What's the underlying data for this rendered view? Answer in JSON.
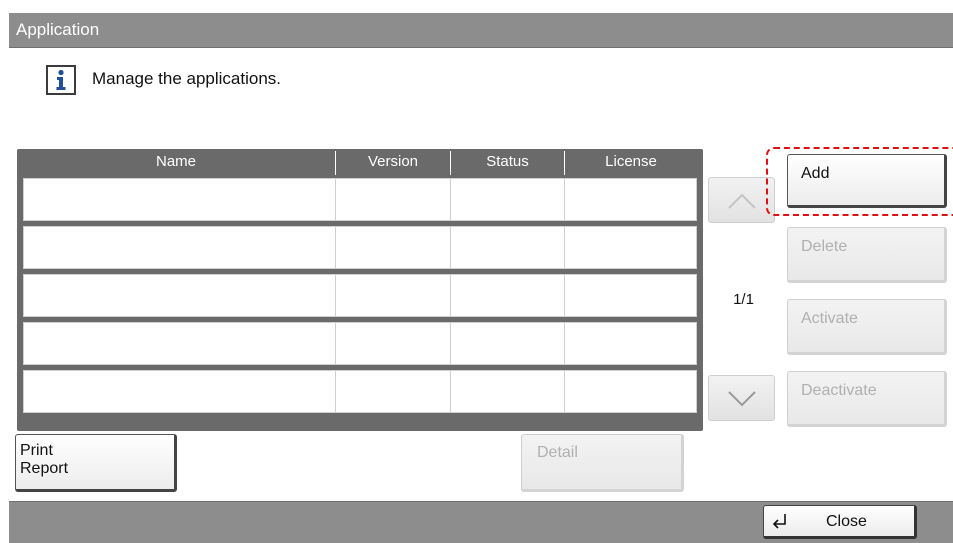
{
  "window": {
    "title": "Application"
  },
  "message": {
    "text": "Manage the applications.",
    "icon": "info-icon"
  },
  "table": {
    "columns": [
      "Name",
      "Version",
      "Status",
      "License"
    ],
    "rows": [
      [
        "",
        "",
        "",
        ""
      ],
      [
        "",
        "",
        "",
        ""
      ],
      [
        "",
        "",
        "",
        ""
      ],
      [
        "",
        "",
        "",
        ""
      ],
      [
        "",
        "",
        "",
        ""
      ]
    ]
  },
  "pagination": {
    "page_label": "1/1",
    "up_icon": "chevron-up-icon",
    "down_icon": "chevron-down-icon"
  },
  "actions": {
    "add": "Add",
    "delete": "Delete",
    "activate": "Activate",
    "deactivate": "Deactivate",
    "print_report": "Print\nReport",
    "detail": "Detail"
  },
  "footer": {
    "close": "Close",
    "close_icon": "enter-return-icon"
  },
  "colors": {
    "highlight": "#e01010",
    "titlebar": "#8d8d8d",
    "table_header": "#6a6a6a"
  }
}
